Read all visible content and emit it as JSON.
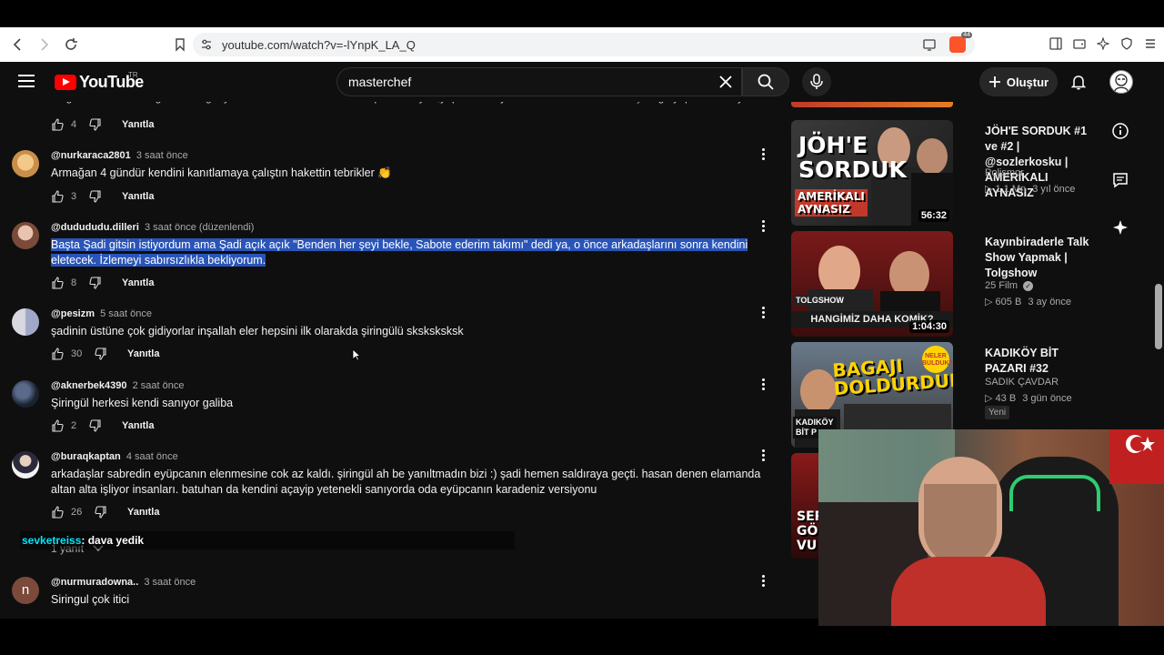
{
  "browser": {
    "url": "youtube.com/watch?v=-lYnpK_LA_Q",
    "brave_badge": "44"
  },
  "masthead": {
    "logo_text": "YouTube",
    "logo_region": "TR",
    "search_value": "masterchef",
    "create_label": "Oluştur"
  },
  "comments": [
    {
      "text": "atağı var* farkında değil ama bağınıyor dikkate alın lütfen inancı hep dua ediyor ,yapım Acun yada Kanarı imren bunu bu çocuğa yapım ekibi ayarın",
      "likes": "4",
      "reply": "Yanıtla"
    },
    {
      "author": "@nurkaraca2801",
      "time": "3 saat önce",
      "text": "Armağan 4 gündür kendini kanıtlamaya çalıştın hakettin tebrikler 👏",
      "likes": "3",
      "reply": "Yanıtla"
    },
    {
      "author": "@dudududu.dilleri",
      "time": "3 saat önce (düzenlendi)",
      "text": "Başta Şadi gitsin istiyordum ama Şadi açık açık \"Benden her şeyi bekle, Sabote ederim takımı\" dedi ya, o önce arkadaşlarını sonra kendini eletecek. İzlemeyi sabırsızlıkla bekliyorum.",
      "likes": "8",
      "reply": "Yanıtla"
    },
    {
      "author": "@pesizm",
      "time": "5 saat önce",
      "text": "şadinin üstüne çok gidiyorlar inşallah eler hepsini ilk olarakda şiringülü sksksksksk",
      "likes": "30",
      "reply": "Yanıtla"
    },
    {
      "author": "@aknerbek4390",
      "time": "2 saat önce",
      "text": "Şiringül herkesi kendi sanıyor galiba",
      "likes": "2",
      "reply": "Yanıtla"
    },
    {
      "author": "@buraqkaptan",
      "time": "4 saat önce",
      "text": "arkadaşlar sabredin eyüpcanın elenmesine cok az kaldı. şiringül ah be yanıltmadın bizi :) şadi hemen saldıraya geçti. hasan denen elamanda altan alta işliyor insanları. batuhan da kendini açayip yetenekli sanıyorda oda eyüpcanın karadeniz versiyonu",
      "likes": "26",
      "reply": "Yanıtla",
      "replies": "1 yanıt"
    },
    {
      "author": "@nurmuradowna..",
      "time": "3 saat önce",
      "avatar_letter": "n",
      "text": "Siringul çok itici"
    }
  ],
  "chat_overlay": {
    "user": "sevketreiss",
    "message": ": dava yedik"
  },
  "sidebar_videos": [
    {
      "thumb_lines": [
        "JÖH'E",
        "SORDUK"
      ],
      "thumb_sub": [
        "AMERİKALI",
        "AYNASIZ"
      ],
      "duration": "56:32",
      "title": "JÖH'E SORDUK #1 ve #2 | @sozlerkosku | AMERİKALI AYNASIZ",
      "channel": "Polismor",
      "views": "1,1 Mn",
      "age": "3 yıl önce"
    },
    {
      "thumb_top": "TOLGSHOW",
      "thumb_banner": "HANGİMİZ DAHA KOMİK?",
      "duration": "1:04:30",
      "title": "Kayınbiraderle Talk Show Yapmak | Tolgshow",
      "channel": "25 Film",
      "views": "605 B",
      "age": "3 ay önce"
    },
    {
      "thumb_lines": [
        "BAGAJI",
        "DOLDURDUK!"
      ],
      "thumb_tag": [
        "NELER",
        "BULDUK?"
      ],
      "thumb_corner": [
        "KADIKÖY",
        "BİT P"
      ],
      "title": "KADIKÖY BİT PAZARI #32",
      "channel": "SADIK ÇAVDAR",
      "views": "43 B",
      "age": "3 gün önce",
      "badge": "Yeni"
    },
    {
      "thumb_lines": [
        "SER",
        "GÖ",
        "VU"
      ]
    }
  ],
  "colors": {
    "background": "#0f0f0f",
    "youtube_red": "#ff0000",
    "selection": "#2a55b8",
    "chat_user": "#00e5ff"
  }
}
